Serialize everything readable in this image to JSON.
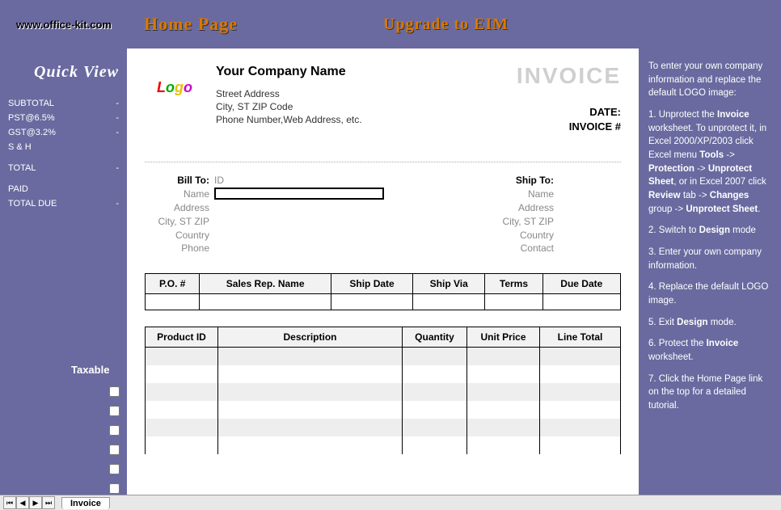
{
  "header": {
    "url": "www.office-kit.com",
    "home": "Home Page",
    "upgrade": "Upgrade to EIM"
  },
  "quickview": {
    "title": "Quick View",
    "rows": [
      {
        "label": "SUBTOTAL",
        "value": "-"
      },
      {
        "label": "PST@6.5%",
        "value": "-"
      },
      {
        "label": "GST@3.2%",
        "value": "-"
      },
      {
        "label": "S & H",
        "value": ""
      },
      {
        "label": "TOTAL",
        "value": "-"
      },
      {
        "label": "PAID",
        "value": ""
      },
      {
        "label": "TOTAL DUE",
        "value": "-"
      }
    ],
    "taxable_label": "Taxable"
  },
  "company": {
    "name": "Your Company Name",
    "street": "Street Address",
    "citystzip": "City, ST  ZIP Code",
    "contact": "Phone Number,Web Address, etc."
  },
  "invoice": {
    "title": "INVOICE",
    "date_label": "DATE:",
    "num_label": "INVOICE #"
  },
  "billto": {
    "title": "Bill To:",
    "fields": [
      "ID",
      "Name",
      "Address",
      "City, ST ZIP",
      "Country",
      "Phone"
    ]
  },
  "shipto": {
    "title": "Ship To:",
    "fields": [
      "Name",
      "Address",
      "City, ST ZIP",
      "Country",
      "Contact"
    ]
  },
  "po_headers": [
    "P.O. #",
    "Sales Rep. Name",
    "Ship Date",
    "Ship Via",
    "Terms",
    "Due Date"
  ],
  "item_headers": [
    "Product ID",
    "Description",
    "Quantity",
    "Unit Price",
    "Line Total"
  ],
  "instructions": {
    "intro": "To enter your own company information and replace the default LOGO image:",
    "s1a": "1. Unprotect the ",
    "s1b": "Invoice",
    "s1c": " worksheet. To unprotect it, in Excel 2000/XP/2003 click Excel menu ",
    "s1d": "Tools",
    "s1e": " -> ",
    "s1f": "Protection",
    "s1g": " -> ",
    "s1h": "Unprotect Sheet",
    "s1i": ", or in Excel 2007 click ",
    "s1j": "Review",
    "s1k": " tab -> ",
    "s1l": "Changes",
    "s1m": " group -> ",
    "s1n": "Unprotect Sheet",
    "s1o": ".",
    "s2a": "2. Switch to ",
    "s2b": "Design",
    "s2c": " mode",
    "s3": "3. Enter your own company information.",
    "s4": "4. Replace the default LOGO image.",
    "s5a": "5. Exit ",
    "s5b": "Design",
    "s5c": " mode.",
    "s6a": "6. Protect the ",
    "s6b": "Invoice",
    "s6c": " worksheet.",
    "s7": "7. Click the Home Page link on the top for a detailed tutorial."
  },
  "tab": {
    "name": "Invoice"
  }
}
